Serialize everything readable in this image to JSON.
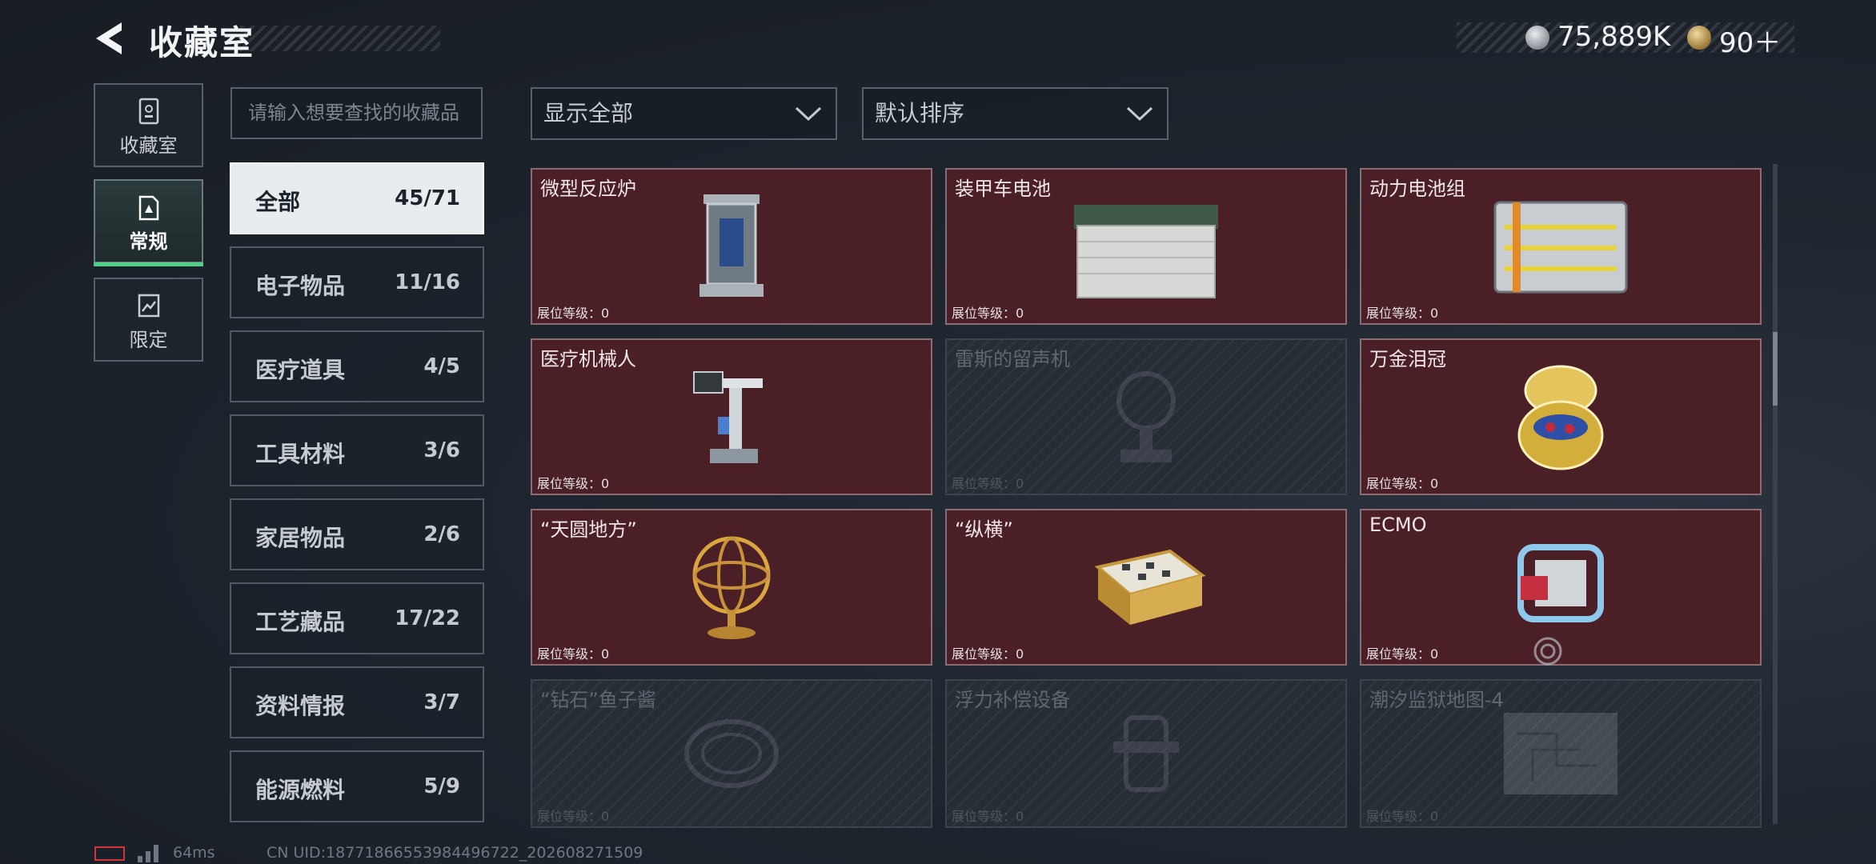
{
  "header": {
    "title": "收藏室",
    "currency": [
      {
        "icon": "silver-coin-icon",
        "value": "75,889K"
      },
      {
        "icon": "gold-coin-icon",
        "value": "90＋"
      }
    ]
  },
  "nav": [
    {
      "label": "收藏室",
      "icon": "trophy-case-icon",
      "active": false
    },
    {
      "label": "常规",
      "icon": "regular-collection-icon",
      "active": true
    },
    {
      "label": "限定",
      "icon": "limited-collection-icon",
      "active": false
    }
  ],
  "search": {
    "placeholder": "请输入想要查找的收藏品"
  },
  "filters": {
    "display": "显示全部",
    "sort": "默认排序"
  },
  "categories": [
    {
      "name": "全部",
      "count": "45/71"
    },
    {
      "name": "电子物品",
      "count": "11/16"
    },
    {
      "name": "医疗道具",
      "count": "4/5"
    },
    {
      "name": "工具材料",
      "count": "3/6"
    },
    {
      "name": "家居物品",
      "count": "2/6"
    },
    {
      "name": "工艺藏品",
      "count": "17/22"
    },
    {
      "name": "资料情报",
      "count": "3/7"
    },
    {
      "name": "能源燃料",
      "count": "5/9"
    }
  ],
  "items": [
    {
      "name": "微型反应炉",
      "level": "展位等级：0",
      "locked": false,
      "icon": "reactor-icon"
    },
    {
      "name": "装甲车电池",
      "level": "展位等级：0",
      "locked": false,
      "icon": "battery-icon"
    },
    {
      "name": "动力电池组",
      "level": "展位等级：0",
      "locked": false,
      "icon": "battery-pack-icon"
    },
    {
      "name": "医疗机械人",
      "level": "展位等级：0",
      "locked": false,
      "icon": "medical-robot-icon"
    },
    {
      "name": "雷斯的留声机",
      "level": "展位等级：0",
      "locked": true,
      "icon": "gramophone-icon"
    },
    {
      "name": "万金泪冠",
      "level": "展位等级：0",
      "locked": false,
      "icon": "jeweled-egg-icon"
    },
    {
      "name": "“天圆地方”",
      "level": "展位等级：0",
      "locked": false,
      "icon": "armillary-sphere-icon"
    },
    {
      "name": "“纵横”",
      "level": "展位等级：0",
      "locked": false,
      "icon": "chess-box-icon"
    },
    {
      "name": "ECMO",
      "level": "展位等级：0",
      "locked": false,
      "icon": "ecmo-machine-icon"
    },
    {
      "name": "“钻石”鱼子酱",
      "level": "展位等级：0",
      "locked": true,
      "icon": "caviar-tin-icon"
    },
    {
      "name": "浮力补偿设备",
      "level": "展位等级：0",
      "locked": true,
      "icon": "buoyancy-device-icon"
    },
    {
      "name": "潮汐监狱地图-4",
      "level": "展位等级：0",
      "locked": true,
      "icon": "map-icon"
    }
  ],
  "footer": {
    "ping": "64ms",
    "uid": "CN UID:18771866553984496722_202608271509"
  },
  "colors": {
    "accent": "#4fd18b",
    "card_unlocked": "#4b1f26",
    "card_locked": "#262d35"
  }
}
